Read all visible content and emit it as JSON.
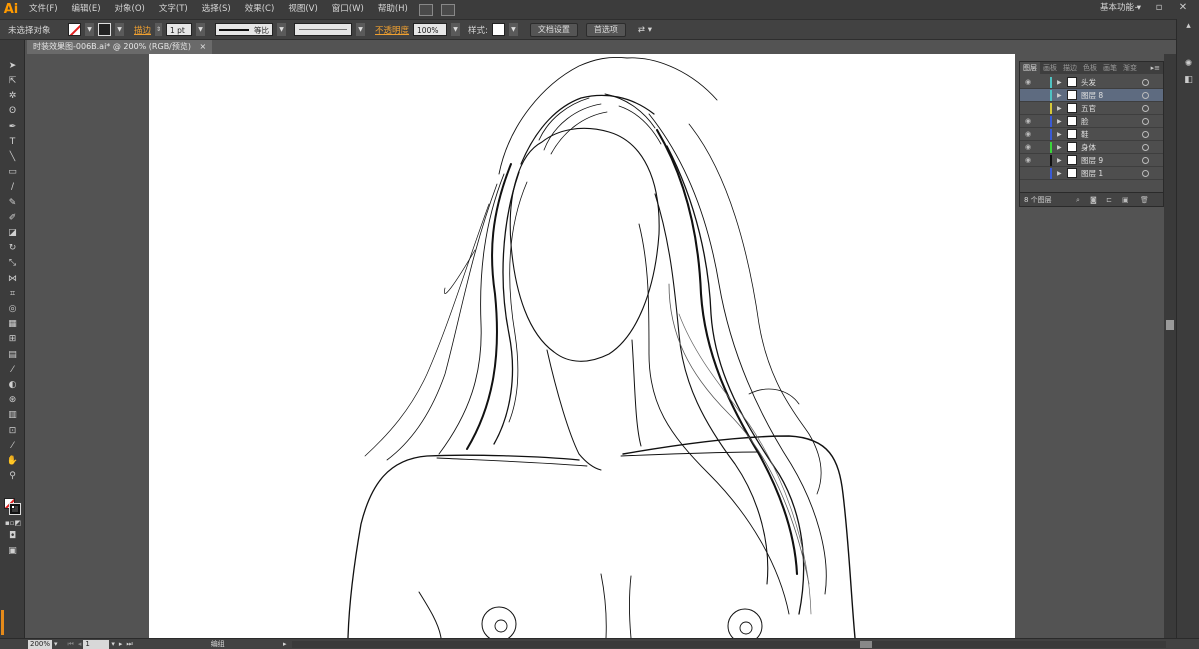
{
  "app": {
    "logo": "Ai"
  },
  "menu": [
    "文件(F)",
    "编辑(E)",
    "对象(O)",
    "文字(T)",
    "选择(S)",
    "效果(C)",
    "视图(V)",
    "窗口(W)",
    "帮助(H)"
  ],
  "workspace": {
    "label": "基本功能"
  },
  "control_bar": {
    "selection_status": "未选择对象",
    "stroke_label": "描边",
    "stroke_weight": "1 pt",
    "stroke_profile": "等比",
    "opacity_label": "不透明度",
    "opacity_value": "100%",
    "style_label": "样式:",
    "doc_setup_button": "文档设置",
    "preferences_button": "首选项"
  },
  "document_tab": {
    "title": "时装效果图-006B.ai* @ 200% (RGB/预览)",
    "close": "×"
  },
  "layers_panel": {
    "tabs": [
      "图层",
      "画板",
      "描边",
      "色板",
      "画笔",
      "渐变"
    ],
    "active_tab": "图层",
    "layers": [
      {
        "name": "头发",
        "visible": true,
        "color": "#4fc3c3",
        "selected": false
      },
      {
        "name": "图层 8",
        "visible": false,
        "color": "#4fc3c3",
        "selected": true
      },
      {
        "name": "五官",
        "visible": false,
        "color": "#d6c83a",
        "selected": false
      },
      {
        "name": "脸",
        "visible": true,
        "color": "#3a5ad6",
        "selected": false
      },
      {
        "name": "鞋",
        "visible": true,
        "color": "#3a5ad6",
        "selected": false
      },
      {
        "name": "身体",
        "visible": true,
        "color": "#3ad63a",
        "selected": false
      },
      {
        "name": "图层 9",
        "visible": true,
        "color": "#111111",
        "selected": false
      },
      {
        "name": "图层 1",
        "visible": false,
        "color": "#3a5ad6",
        "selected": false
      }
    ],
    "count_label": "8 个图层"
  },
  "status_bar": {
    "zoom": "200%",
    "artboard_number": "1",
    "tool_label": "编组"
  },
  "colors": {
    "accent_orange": "#f0a030",
    "selection_blue": "#5e6b80",
    "artboard": "#ffffff"
  }
}
